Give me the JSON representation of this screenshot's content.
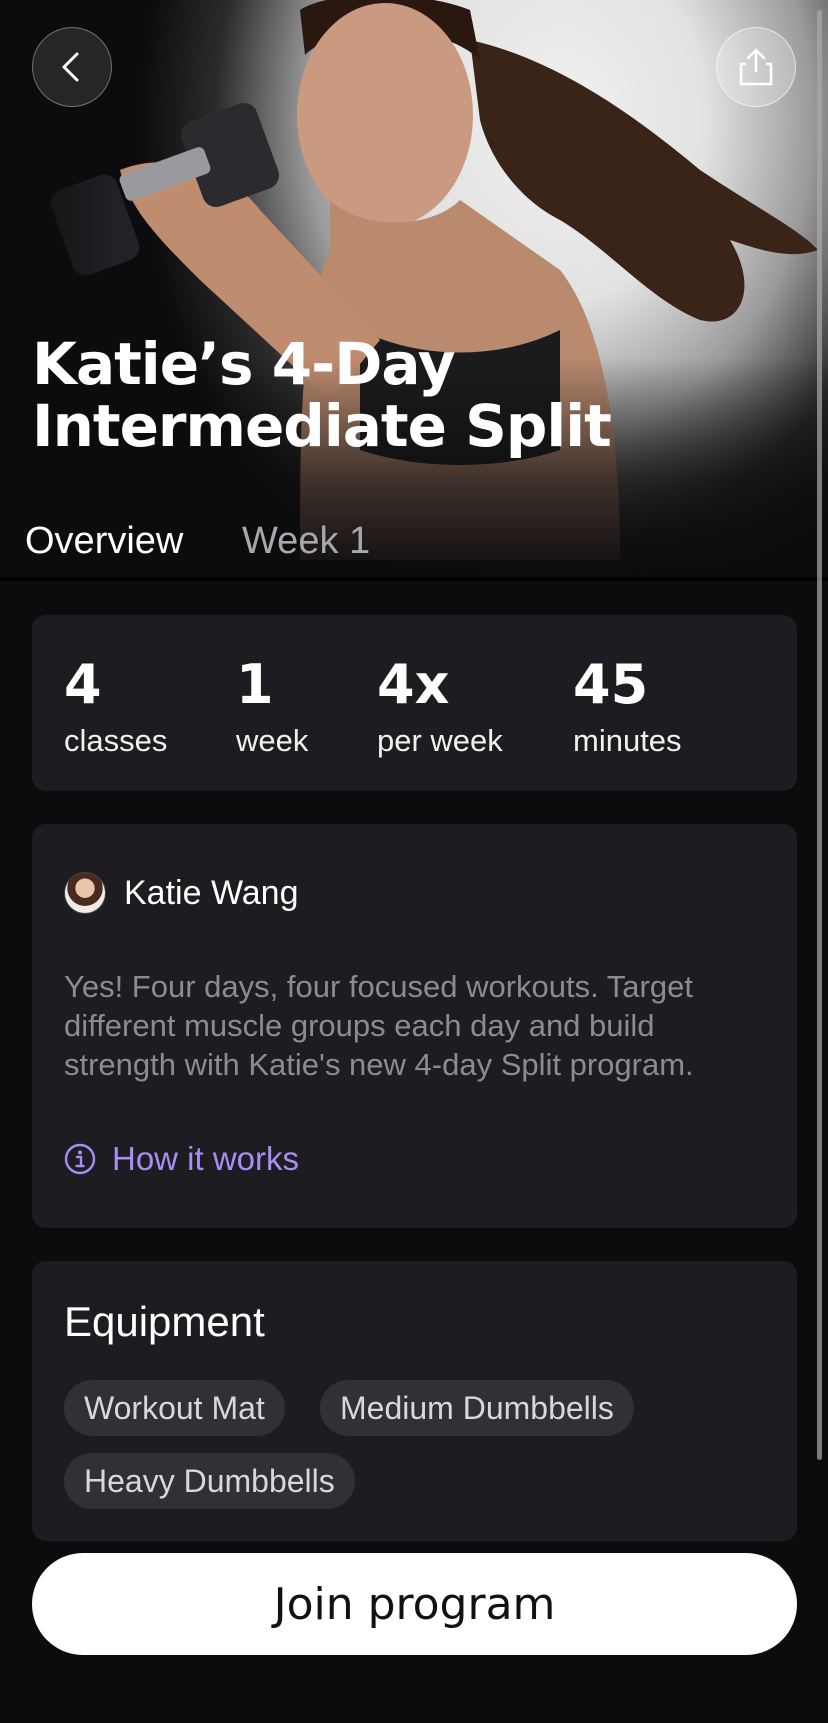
{
  "program": {
    "title": "Katie’s 4-Day\nIntermediate Split"
  },
  "tabs": [
    {
      "label": "Overview",
      "active": true
    },
    {
      "label": "Week 1",
      "active": false
    }
  ],
  "stats": [
    {
      "value": "4",
      "label": "classes"
    },
    {
      "value": "1",
      "label": "week"
    },
    {
      "value": "4x",
      "label": "per week"
    },
    {
      "value": "45",
      "label": "minutes"
    }
  ],
  "coach": {
    "name": "Katie Wang",
    "description": "Yes! Four days, four focused workouts. Target different muscle groups each day and build strength with Katie's new 4-day Split program.",
    "how_it_works_label": "How it works"
  },
  "equipment": {
    "title": "Equipment",
    "items": [
      "Workout Mat",
      "Medium Dumbbells",
      "Heavy Dumbbells"
    ]
  },
  "cta": {
    "label": "Join program"
  },
  "icons": {
    "back": "chevron-left-icon",
    "share": "share-icon",
    "info": "info-circle-icon"
  },
  "colors": {
    "background": "#0c0c0e",
    "card": "#1d1d21",
    "chip": "#303035",
    "accent": "#a98df5",
    "muted_text": "#8b8b90"
  }
}
